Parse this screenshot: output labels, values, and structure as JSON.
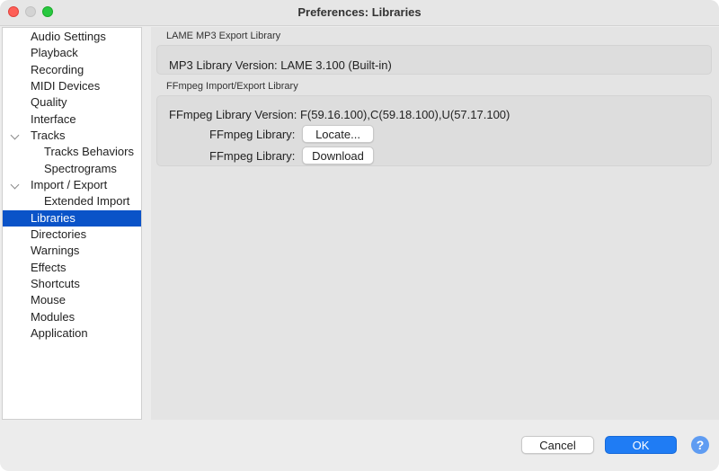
{
  "window": {
    "title": "Preferences: Libraries"
  },
  "sidebar": {
    "items": [
      {
        "label": "Audio Settings"
      },
      {
        "label": "Playback"
      },
      {
        "label": "Recording"
      },
      {
        "label": "MIDI Devices"
      },
      {
        "label": "Quality"
      },
      {
        "label": "Interface"
      },
      {
        "label": "Tracks",
        "expanded": true
      },
      {
        "label": "Tracks Behaviors"
      },
      {
        "label": "Spectrograms"
      },
      {
        "label": "Import / Export",
        "expanded": true
      },
      {
        "label": "Extended Import"
      },
      {
        "label": "Libraries",
        "selected": true
      },
      {
        "label": "Directories"
      },
      {
        "label": "Warnings"
      },
      {
        "label": "Effects"
      },
      {
        "label": "Shortcuts"
      },
      {
        "label": "Mouse"
      },
      {
        "label": "Modules"
      },
      {
        "label": "Application"
      }
    ]
  },
  "lame": {
    "group_label": "LAME MP3 Export Library",
    "version_text": "MP3 Library Version: LAME 3.100 (Built-in)"
  },
  "ffmpeg": {
    "group_label": "FFmpeg Import/Export Library",
    "version_text": "FFmpeg Library Version: F(59.16.100),C(59.18.100),U(57.17.100)",
    "locate_label": "FFmpeg Library:",
    "locate_button": "Locate...",
    "download_label": "FFmpeg Library:",
    "download_button": "Download"
  },
  "footer": {
    "cancel": "Cancel",
    "ok": "OK",
    "help": "?"
  },
  "colors": {
    "selection": "#0a53c8",
    "ok_button": "#1f7cf4",
    "help_button": "#5f9cf2"
  },
  "icons": {
    "close": "close-icon",
    "minimize": "minimize-icon",
    "zoom": "zoom-icon",
    "disclosure": "chevron-down-icon",
    "help": "help-icon"
  }
}
